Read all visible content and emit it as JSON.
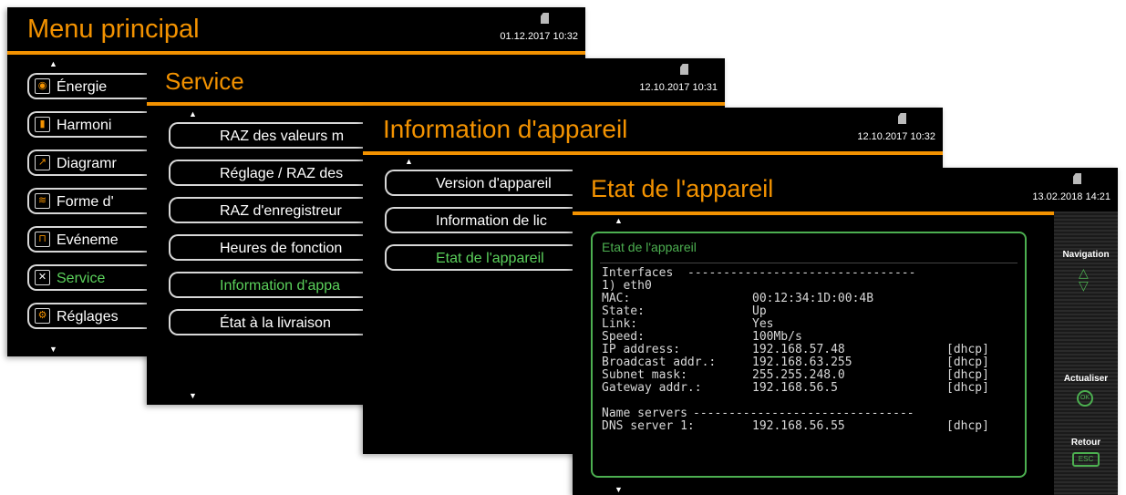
{
  "colors": {
    "accent": "#f39200",
    "active": "#5bd15b",
    "panel_border": "#4caf50"
  },
  "screen1": {
    "title": "Menu principal",
    "datetime": "01.12.2017 10:32",
    "items": [
      {
        "label": "Énergie",
        "icon": "meter-icon"
      },
      {
        "label": "Harmoni",
        "icon": "bar-chart-icon"
      },
      {
        "label": "Diagramr",
        "icon": "diagram-icon"
      },
      {
        "label": "Forme d'",
        "icon": "waveform-icon"
      },
      {
        "label": "Evéneme",
        "icon": "event-icon"
      },
      {
        "label": "Service",
        "icon": "tools-icon",
        "active": true
      },
      {
        "label": "Réglages",
        "icon": "gears-icon"
      }
    ]
  },
  "screen2": {
    "title": "Service",
    "datetime": "12.10.2017  10:31",
    "items": [
      {
        "label": "RAZ des valeurs m"
      },
      {
        "label": "Réglage / RAZ des"
      },
      {
        "label": "RAZ d'enregistreur"
      },
      {
        "label": "Heures de fonction"
      },
      {
        "label": "Information d'appa",
        "active": true
      },
      {
        "label": "État à la livraison"
      }
    ]
  },
  "screen3": {
    "title": "Information d'appareil",
    "datetime": "12.10.2017  10:32",
    "items": [
      {
        "label": "Version d'appareil"
      },
      {
        "label": "Information de lic"
      },
      {
        "label": "Etat de l'appareil",
        "active": true
      }
    ]
  },
  "screen4": {
    "title": "Etat de l'appareil",
    "datetime": "13.02.2018  14:21",
    "panel_title": "Etat de l'appareil",
    "rows": [
      {
        "k": "Interfaces",
        "v": "",
        "t": "",
        "dashes": "--------------------------------"
      },
      {
        "k": "1) eth0",
        "v": "",
        "t": ""
      },
      {
        "k": "MAC:",
        "v": "00:12:34:1D:00:4B",
        "t": ""
      },
      {
        "k": "State:",
        "v": "Up",
        "t": ""
      },
      {
        "k": "Link:",
        "v": "Yes",
        "t": ""
      },
      {
        "k": "Speed:",
        "v": "100Mb/s",
        "t": ""
      },
      {
        "k": "IP address:",
        "v": "192.168.57.48",
        "t": "[dhcp]"
      },
      {
        "k": "Broadcast addr.:",
        "v": "192.168.63.255",
        "t": "[dhcp]"
      },
      {
        "k": "Subnet mask:",
        "v": "255.255.248.0",
        "t": "[dhcp]"
      },
      {
        "k": "Gateway addr.:",
        "v": "192.168.56.5",
        "t": "[dhcp]"
      },
      {
        "k": "",
        "v": "",
        "t": ""
      },
      {
        "k": "Name servers",
        "v": "",
        "t": "",
        "dashes": "-------------------------------"
      },
      {
        "k": "DNS server 1:",
        "v": "192.168.56.55",
        "t": "[dhcp]"
      }
    ],
    "side": {
      "navigation": "Navigation",
      "refresh": "Actualiser",
      "refresh_key": "OK",
      "back": "Retour",
      "back_key": "ESC"
    }
  }
}
